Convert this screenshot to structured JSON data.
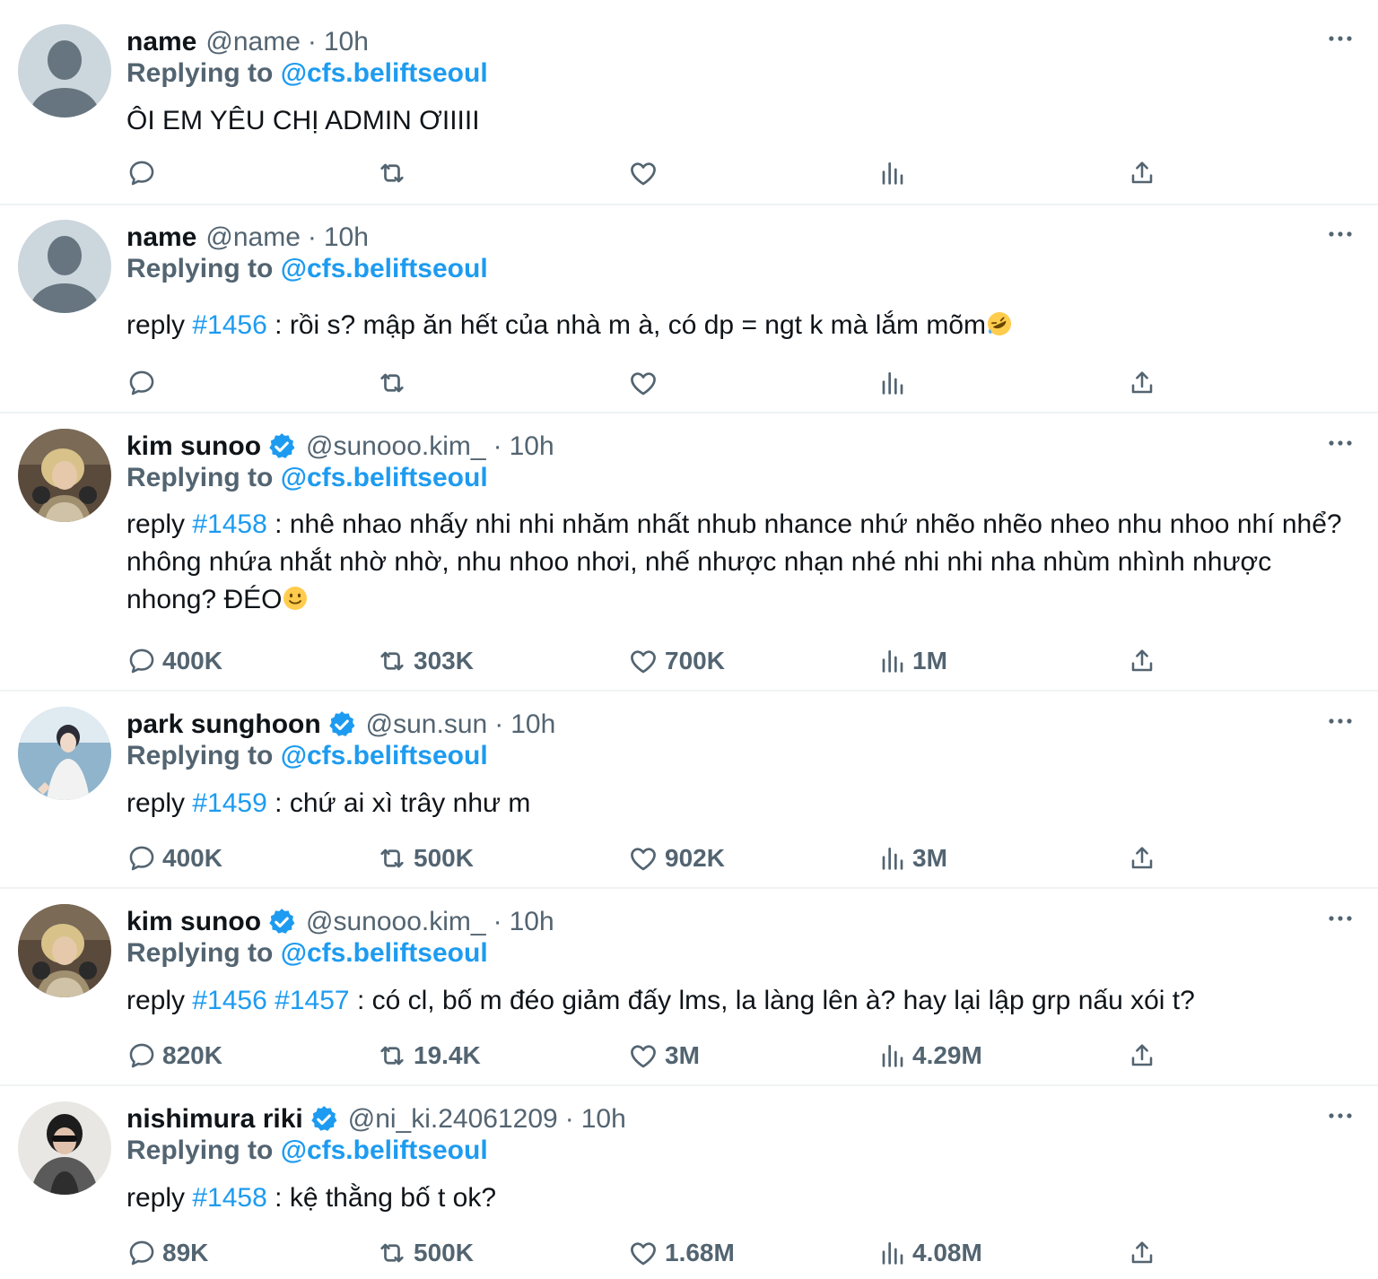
{
  "replying_label": "Replying to",
  "tweets": [
    {
      "display_name": "name",
      "handle": "@name",
      "sep": "·",
      "time": "10h",
      "verified": false,
      "mention": "@cfs.beliftseoul",
      "text": "ÔI EM YÊU CHỊ ADMIN ƠIIIII",
      "counts": {
        "reply": "",
        "retweet": "",
        "like": "",
        "views": ""
      }
    },
    {
      "display_name": "name",
      "handle": "@name",
      "sep": "·",
      "time": "10h",
      "verified": false,
      "mention": "@cfs.beliftseoul",
      "reply_prefix": "reply",
      "hashtags": [
        "#1456"
      ],
      "text": ": rồi s? mập ăn hết của nhà m à, có dp = ngt k mà lắm mõm",
      "emoji": "rofl-emoji",
      "counts": {
        "reply": "",
        "retweet": "",
        "like": "",
        "views": ""
      }
    },
    {
      "display_name": "kim sunoo",
      "handle": "@sunooo.kim_",
      "sep": "·",
      "time": "10h",
      "verified": true,
      "mention": "@cfs.beliftseoul",
      "reply_prefix": "reply",
      "hashtags": [
        "#1458"
      ],
      "text": ": nhê nhao nhấy nhi nhi nhăm nhất nhub nhance nhứ nhẽo nhẽo nheo nhu nhoo nhí nhể? nhông nhứa nhắt nhờ nhờ, nhu nhoo nhơi, nhế nhược nhạn nhé nhi nhi nha nhùm nhình nhược nhong? ĐÉO",
      "emoji": "slight-smile-emoji",
      "counts": {
        "reply": "400K",
        "retweet": "303K",
        "like": "700K",
        "views": "1M"
      }
    },
    {
      "display_name": "park sunghoon",
      "handle": "@sun.sun",
      "sep": "·",
      "time": "10h",
      "verified": true,
      "mention": "@cfs.beliftseoul",
      "reply_prefix": "reply",
      "hashtags": [
        "#1459"
      ],
      "text": ": chứ ai xì trây như m",
      "counts": {
        "reply": "400K",
        "retweet": "500K",
        "like": "902K",
        "views": "3M"
      }
    },
    {
      "display_name": "kim sunoo",
      "handle": "@sunooo.kim_",
      "sep": "·",
      "time": "10h",
      "verified": true,
      "mention": "@cfs.beliftseoul",
      "reply_prefix": "reply",
      "hashtags": [
        "#1456",
        "#1457"
      ],
      "text": ": có cl, bố m đéo giảm đấy lms, la làng lên à? hay lại lập grp nấu xói t?",
      "counts": {
        "reply": "820K",
        "retweet": "19.4K",
        "like": "3M",
        "views": "4.29M"
      }
    },
    {
      "display_name": "nishimura riki",
      "handle": "@ni_ki.24061209",
      "sep": "·",
      "time": "10h",
      "verified": true,
      "mention": "@cfs.beliftseoul",
      "reply_prefix": "reply",
      "hashtags": [
        "#1458"
      ],
      "text": ": kệ thằng bố t ok?",
      "counts": {
        "reply": "89K",
        "retweet": "500K",
        "like": "1.68M",
        "views": "4.08M"
      }
    }
  ],
  "colors": {
    "accent": "#1d9bf0",
    "muted": "#536471",
    "text": "#0f1419",
    "divider": "#eff3f4"
  },
  "icons": [
    "reply-icon",
    "retweet-icon",
    "like-icon",
    "views-icon",
    "share-icon",
    "more-icon",
    "verified-badge-icon"
  ]
}
